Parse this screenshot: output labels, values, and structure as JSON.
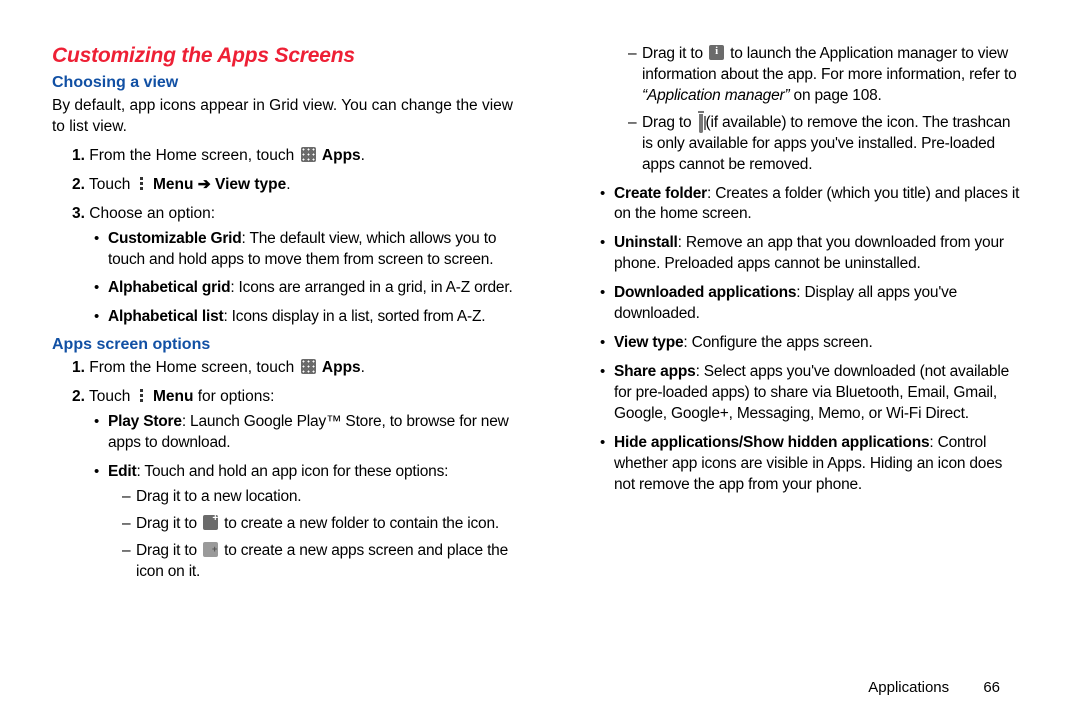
{
  "section": {
    "title": "Customizing the Apps Screens",
    "choosing": {
      "heading": "Choosing a view",
      "intro": "By default, app icons appear in Grid view. You can change the view to list view.",
      "step1_a": "From the Home screen, touch ",
      "step1_b": "Apps",
      "step1_c": ".",
      "step2_a": "Touch ",
      "step2_b": "Menu ➔ View type",
      "step2_c": ".",
      "step3": "Choose an option:",
      "opt1_b": "Customizable Grid",
      "opt1_t": ": The default view, which allows you to touch and hold apps to move them from screen to screen.",
      "opt2_b": "Alphabetical grid",
      "opt2_t": ": Icons are arranged in a grid, in A-Z order.",
      "opt3_b": "Alphabetical list",
      "opt3_t": ": Icons display in a list, sorted from A-Z."
    },
    "options": {
      "heading": "Apps screen options",
      "step1_a": "From the Home screen, touch ",
      "step1_b": "Apps",
      "step1_c": ".",
      "step2_a": "Touch ",
      "step2_b": "Menu",
      "step2_c": " for options:",
      "play_b": "Play Store",
      "play_t": ": Launch Google Play™ Store, to browse for new apps to download.",
      "edit_b": "Edit",
      "edit_t": ": Touch and hold an app icon for these options:",
      "edit_d1": "Drag it to a new location.",
      "edit_d2_a": "Drag it to ",
      "edit_d2_b": " to create a new folder to contain the icon.",
      "edit_d3_a": "Drag it to ",
      "edit_d3_b": " to create a new apps screen and place the icon on it.",
      "edit_d4_a": "Drag it to ",
      "edit_d4_b": " to launch the Application manager to view information about the app. For more information, refer to ",
      "edit_d4_c": "“Application manager”",
      "edit_d4_d": " on page 108.",
      "edit_d5_a": "Drag to ",
      "edit_d5_b": " (if available) to remove the icon. The trashcan is only available for apps you've installed. Pre-loaded apps cannot be removed.",
      "createfolder_b": "Create folder",
      "createfolder_t": ": Creates a folder (which you title) and places it on the home screen.",
      "uninstall_b": "Uninstall",
      "uninstall_t": ": Remove an app that you downloaded from your phone. Preloaded apps cannot be uninstalled.",
      "downloaded_b": "Downloaded applications",
      "downloaded_t": ": Display all apps you've downloaded.",
      "viewtype_b": "View type",
      "viewtype_t": ": Configure the apps screen.",
      "share_b": "Share apps",
      "share_t": ": Select apps you've downloaded (not available for pre-loaded apps) to share via Bluetooth, Email, Gmail, Google, Google+, Messaging, Memo, or Wi-Fi Direct.",
      "hide_b": "Hide applications/Show hidden applications",
      "hide_t": ": Control whether app icons are visible in Apps. Hiding an icon does not remove the app from your phone."
    }
  },
  "footer": {
    "section": "Applications",
    "page": "66"
  }
}
